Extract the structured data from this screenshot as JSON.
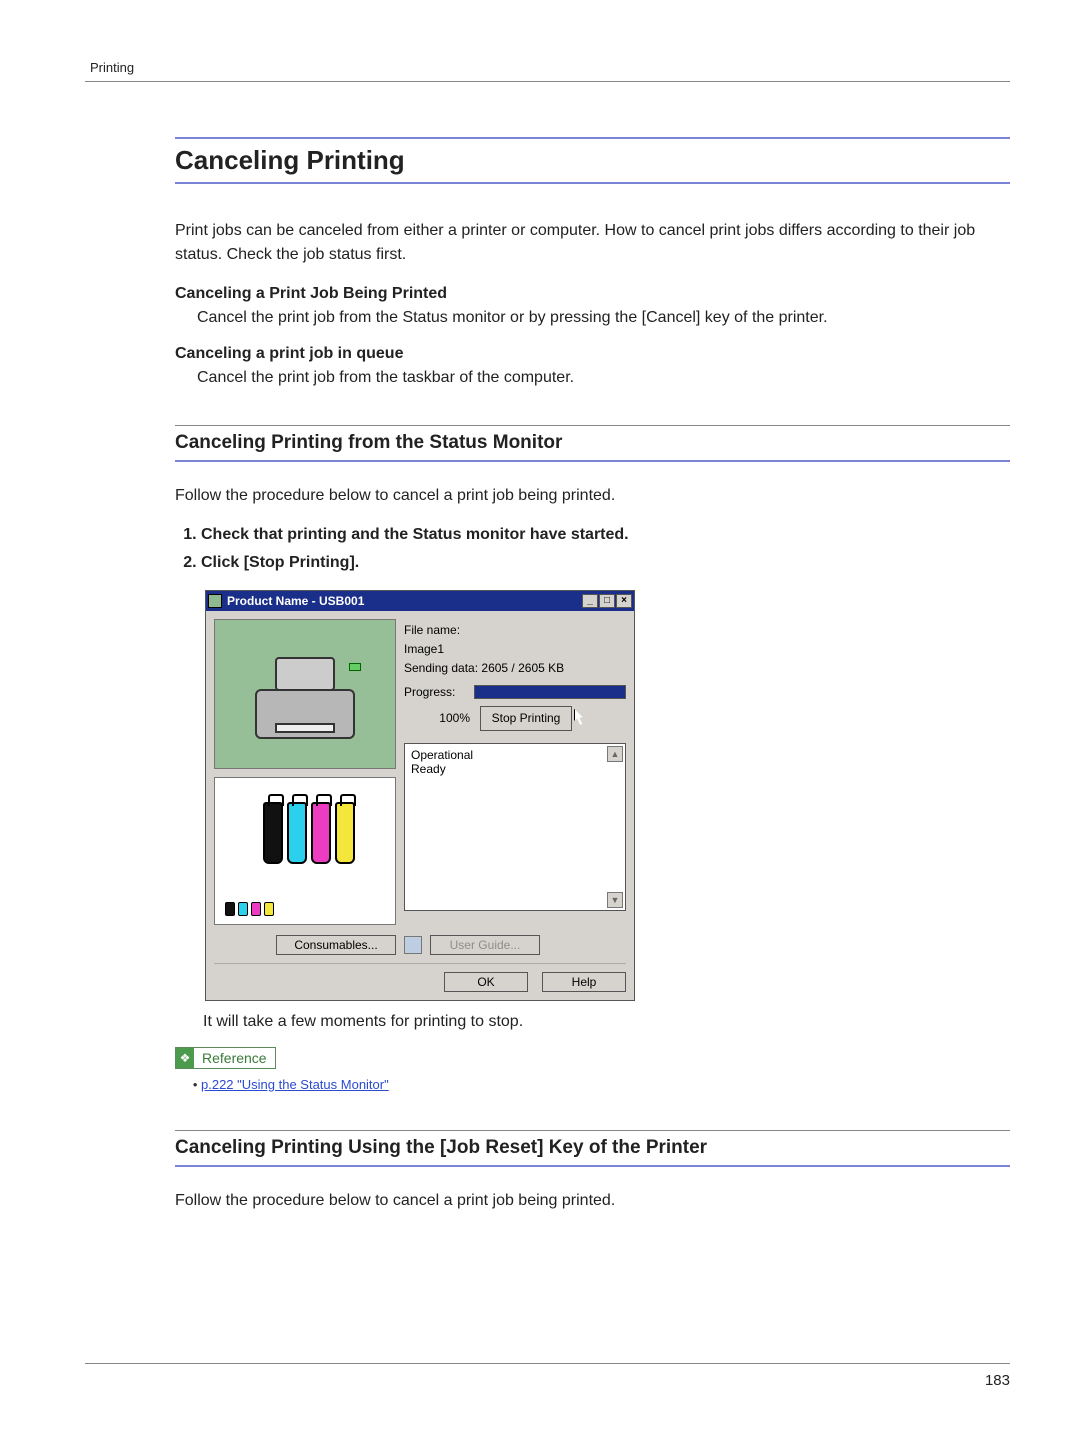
{
  "running_head": "Printing",
  "page_number": "183",
  "h1": "Canceling Printing",
  "intro": "Print jobs can be canceled from either a printer or computer. How to cancel print jobs differs according to their job status. Check the job status first.",
  "sec_a": {
    "title": "Canceling a Print Job Being Printed",
    "body": "Cancel the print job from the Status monitor or by pressing the [Cancel] key of the printer."
  },
  "sec_b": {
    "title": "Canceling a print job in queue",
    "body": "Cancel the print job from the taskbar of the computer."
  },
  "h2a": "Canceling Printing from the Status Monitor",
  "h2a_lead": "Follow the procedure below to cancel a print job being printed.",
  "steps": {
    "s1": "Check that printing and the Status monitor have started.",
    "s2": "Click [Stop Printing]."
  },
  "after_step_note": "It will take a few moments for printing to stop.",
  "reference_label": "Reference",
  "reference_link": "p.222 \"Using the Status Monitor\"",
  "h2b": "Canceling Printing Using the [Job Reset] Key of the Printer",
  "h2b_lead": "Follow the procedure below to cancel a print job being printed.",
  "status_monitor": {
    "title": "Product Name  - USB001",
    "file_name_label": "File name:",
    "file_name": "Image1",
    "sending": "Sending data: 2605 / 2605 KB",
    "progress_label": "Progress:",
    "progress_value": "100%",
    "progress_pct": 100,
    "stop_btn": "Stop Printing",
    "status_line1": "Operational",
    "status_line2": "Ready",
    "consumables_btn": "Consumables...",
    "user_guide_btn": "User Guide...",
    "ok_btn": "OK",
    "help_btn": "Help",
    "win_min": "_",
    "win_max": "□",
    "win_close": "×"
  }
}
